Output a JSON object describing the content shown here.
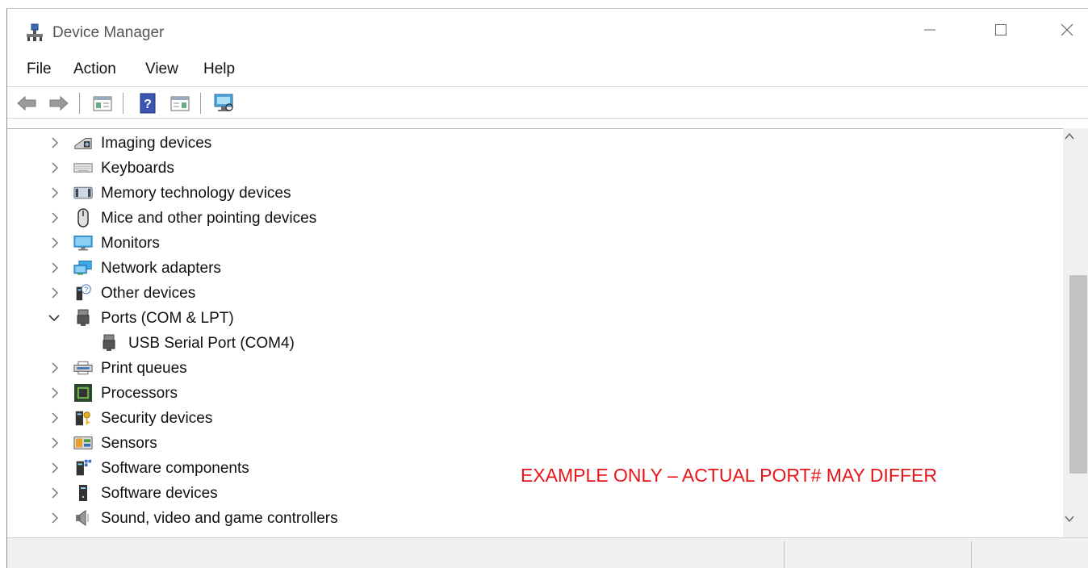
{
  "window": {
    "title": "Device Manager"
  },
  "menu": {
    "file": "File",
    "action": "Action",
    "view": "View",
    "help": "Help"
  },
  "toolbar": {
    "buttons": [
      "back-arrow-icon",
      "forward-arrow-icon",
      "show-hide-console-tree-icon",
      "help-icon",
      "properties-pane-icon",
      "scan-hardware-monitor-icon"
    ]
  },
  "tree": {
    "items": [
      {
        "label": "Imaging devices",
        "icon": "camera-icon",
        "expanded": false
      },
      {
        "label": "Keyboards",
        "icon": "keyboard-icon",
        "expanded": false
      },
      {
        "label": "Memory technology devices",
        "icon": "memory-card-icon",
        "expanded": false
      },
      {
        "label": "Mice and other pointing devices",
        "icon": "mouse-icon",
        "expanded": false
      },
      {
        "label": "Monitors",
        "icon": "monitor-icon",
        "expanded": false
      },
      {
        "label": "Network adapters",
        "icon": "network-adapter-icon",
        "expanded": false
      },
      {
        "label": "Other devices",
        "icon": "unknown-device-icon",
        "expanded": false
      },
      {
        "label": "Ports (COM & LPT)",
        "icon": "port-icon",
        "expanded": true
      },
      {
        "label": "USB Serial Port (COM4)",
        "icon": "port-icon",
        "child": true
      },
      {
        "label": "Print queues",
        "icon": "printer-icon",
        "expanded": false
      },
      {
        "label": "Processors",
        "icon": "processor-icon",
        "expanded": false
      },
      {
        "label": "Security devices",
        "icon": "security-key-icon",
        "expanded": false
      },
      {
        "label": "Sensors",
        "icon": "sensor-icon",
        "expanded": false
      },
      {
        "label": "Software components",
        "icon": "software-component-icon",
        "expanded": false
      },
      {
        "label": "Software devices",
        "icon": "software-device-icon",
        "expanded": false
      },
      {
        "label": "Sound, video and game controllers",
        "icon": "speaker-icon",
        "expanded": false
      }
    ]
  },
  "annotation": "EXAMPLE ONLY – ACTUAL PORT# MAY DIFFER",
  "colors": {
    "annotation": "#e8141a",
    "scrollbar_thumb": "#c2c2c2",
    "statusbar": "#f0f0f0"
  }
}
